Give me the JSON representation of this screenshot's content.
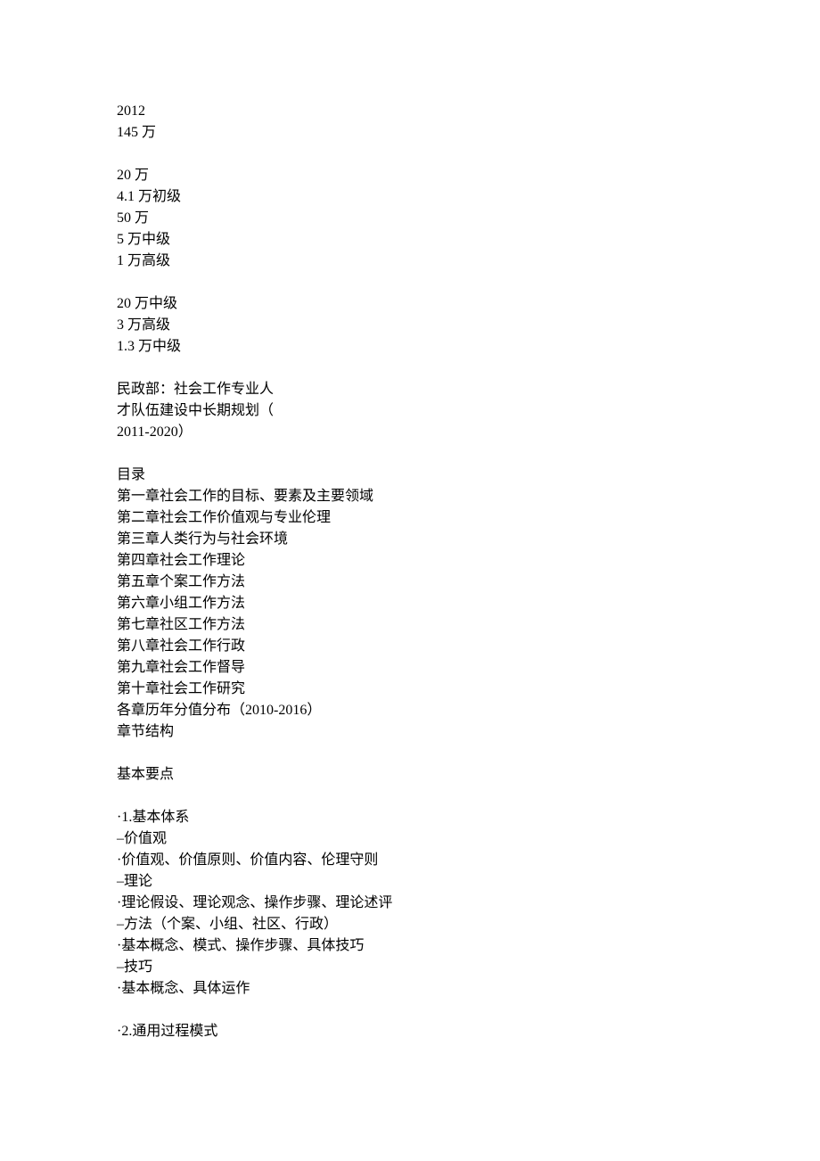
{
  "block1": {
    "l1": "2012",
    "l2": "145 万"
  },
  "block2": {
    "l1": "20 万",
    "l2": "4.1 万初级",
    "l3": "50 万",
    "l4": "5 万中级",
    "l5": "1 万高级"
  },
  "block3": {
    "l1": "20 万中级",
    "l2": "3 万高级",
    "l3": "1.3 万中级"
  },
  "block4": {
    "l1": "民政部：社会工作专业人",
    "l2": "才队伍建设中长期规划（",
    "l3": "2011-2020）"
  },
  "block5": {
    "l1": "目录",
    "l2": "第一章社会工作的目标、要素及主要领域",
    "l3": "第二章社会工作价值观与专业伦理",
    "l4": "第三章人类行为与社会环境",
    "l5": "第四章社会工作理论",
    "l6": "第五章个案工作方法",
    "l7": "第六章小组工作方法",
    "l8": "第七章社区工作方法",
    "l9": "第八章社会工作行政",
    "l10": "第九章社会工作督导",
    "l11": "第十章社会工作研究",
    "l12": "各章历年分值分布（2010-2016）",
    "l13": "章节结构"
  },
  "block6": {
    "l1": "基本要点"
  },
  "block7": {
    "l1": "·1.基本体系",
    "l2": "–价值观",
    "l3": "·价值观、价值原则、价值内容、伦理守则",
    "l4": "–理论",
    "l5": "·理论假设、理论观念、操作步骤、理论述评",
    "l6": "–方法（个案、小组、社区、行政）",
    "l7": "·基本概念、模式、操作步骤、具体技巧",
    "l8": "–技巧",
    "l9": "·基本概念、具体运作"
  },
  "block8": {
    "l1": "·2.通用过程模式"
  }
}
